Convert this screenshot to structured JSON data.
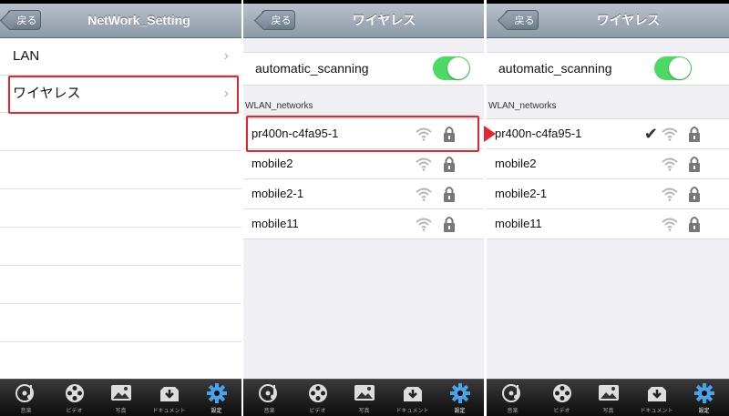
{
  "colors": {
    "accent_red": "#e8232c",
    "toggle_on": "#4cd964",
    "active_tab": "#4aa3e8"
  },
  "back_label": "戻る",
  "panel1": {
    "title": "NetWork_Setting",
    "items": [
      {
        "label": "LAN"
      },
      {
        "label": "ワイヤレス"
      }
    ]
  },
  "panel2": {
    "title": "ワイヤレス",
    "scan_label": "automatic_scanning",
    "scan_on": true,
    "section_label": "WLAN_networks",
    "networks": [
      {
        "name": "pr400n-c4fa95-1",
        "secured": true
      },
      {
        "name": "mobile2",
        "secured": true
      },
      {
        "name": "mobile2-1",
        "secured": true
      },
      {
        "name": "mobile11",
        "secured": true
      }
    ]
  },
  "panel3": {
    "title": "ワイヤレス",
    "scan_label": "automatic_scanning",
    "scan_on": true,
    "section_label": "WLAN_networks",
    "networks": [
      {
        "name": "pr400n-c4fa95-1",
        "secured": true,
        "connected": true,
        "check_icon": "checkmark-icon"
      },
      {
        "name": "mobile2",
        "secured": true
      },
      {
        "name": "mobile2-1",
        "secured": true
      },
      {
        "name": "mobile11",
        "secured": true
      }
    ]
  },
  "tabs": [
    {
      "label": "音楽",
      "icon": "music-icon"
    },
    {
      "label": "ビデオ",
      "icon": "film-reel-icon"
    },
    {
      "label": "写真",
      "icon": "photo-icon"
    },
    {
      "label": "ドキュメント",
      "icon": "document-download-icon"
    },
    {
      "label": "設定",
      "icon": "gear-icon",
      "active": true
    }
  ]
}
